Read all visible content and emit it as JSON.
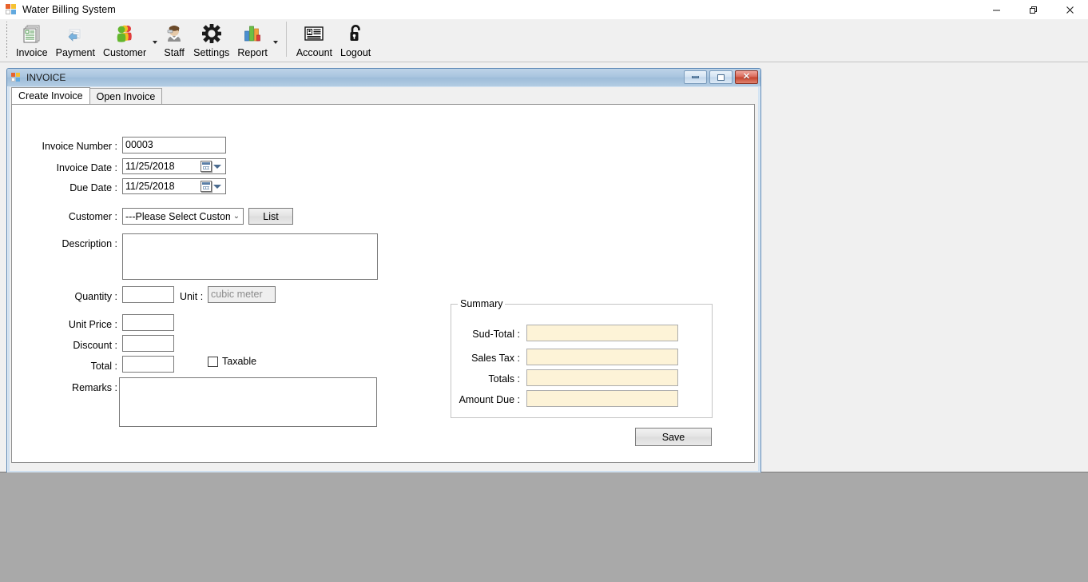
{
  "window": {
    "title": "Water Billing System",
    "icon": "app-squares-icon",
    "controls": {
      "minimize": "minimize-icon",
      "maximize": "restore-icon",
      "close": "close-icon"
    }
  },
  "toolbar": {
    "items": [
      {
        "label": "Invoice",
        "icon": "invoice-document-icon",
        "has_dropdown": false
      },
      {
        "label": "Payment",
        "icon": "payment-money-icon",
        "has_dropdown": false
      },
      {
        "label": "Customer",
        "icon": "customer-people-icon",
        "has_dropdown": true
      },
      {
        "label": "Staff",
        "icon": "staff-person-icon",
        "has_dropdown": false
      },
      {
        "label": "Settings",
        "icon": "gear-icon",
        "has_dropdown": false
      },
      {
        "label": "Report",
        "icon": "bar-chart-icon",
        "has_dropdown": true
      }
    ],
    "items_right": [
      {
        "label": "Account",
        "icon": "id-card-icon",
        "has_dropdown": false
      },
      {
        "label": "Logout",
        "icon": "open-padlock-icon",
        "has_dropdown": false
      }
    ]
  },
  "child_window": {
    "title": "INVOICE",
    "icon": "form-squares-icon",
    "controls": {
      "minimize": "minimize-icon",
      "maximize": "maximize-icon",
      "close": "close-icon"
    },
    "tabs": [
      {
        "label": "Create Invoice",
        "active": true
      },
      {
        "label": "Open Invoice",
        "active": false
      }
    ]
  },
  "form": {
    "invoice_number": {
      "label": "Invoice Number :",
      "value": "00003"
    },
    "invoice_date": {
      "label": "Invoice Date :",
      "value": "11/25/2018"
    },
    "due_date": {
      "label": "Due Date :",
      "value": "11/25/2018"
    },
    "customer": {
      "label": "Customer :",
      "value": "---Please Select Customer--"
    },
    "list_button": {
      "label": "List"
    },
    "description": {
      "label": "Description :",
      "value": ""
    },
    "quantity": {
      "label": "Quantity :",
      "value": ""
    },
    "unit": {
      "label": "Unit :",
      "value": "cubic meter"
    },
    "unit_price": {
      "label": "Unit Price :",
      "value": ""
    },
    "discount": {
      "label": "Discount :",
      "value": ""
    },
    "total": {
      "label": "Total :",
      "value": ""
    },
    "taxable": {
      "label": "Taxable",
      "checked": false
    },
    "remarks": {
      "label": "Remarks :",
      "value": ""
    }
  },
  "summary": {
    "title": "Summary",
    "rows": [
      {
        "label": "Sud-Total :",
        "value": ""
      },
      {
        "label": "Sales Tax :",
        "value": ""
      },
      {
        "label": "Totals :",
        "value": ""
      },
      {
        "label": "Amount Due :",
        "value": ""
      }
    ]
  },
  "actions": {
    "save_label": "Save"
  },
  "colors": {
    "desktop_background": "#a9a9a9",
    "window_chrome": "#f0f0f0",
    "child_titlebar": "#a8c4de",
    "summary_field": "#fdf3d7",
    "readonly_field": "#efefef"
  }
}
